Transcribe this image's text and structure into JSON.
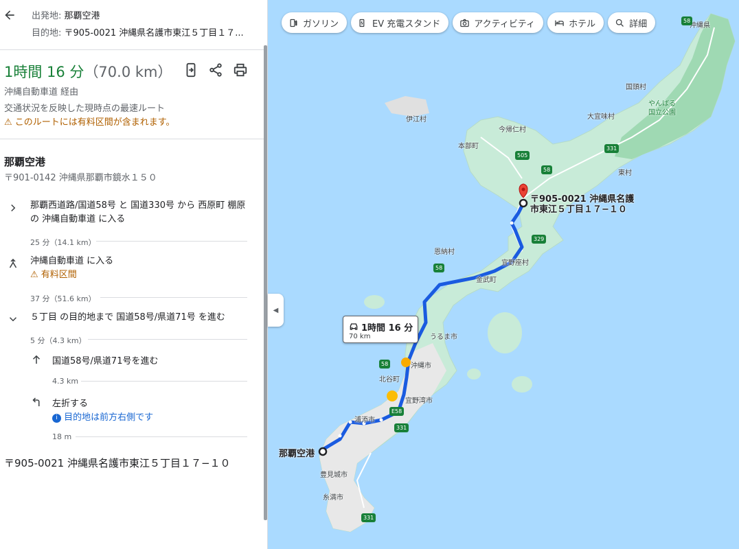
{
  "origin": {
    "label": "出発地:",
    "value": "那覇空港"
  },
  "destination": {
    "label": "目的地:",
    "value": "〒905-0021 沖縄県名護市東江５丁目１７..."
  },
  "summary": {
    "duration": "1時間 16 分",
    "distance": "（70.0 km）",
    "via": "沖縄自動車道 経由",
    "description": "交通状況を反映した現時点の最速ルート",
    "warning": "このルートには有料区間が含まれます。"
  },
  "start": {
    "name": "那覇空港",
    "address": "〒901-0142 沖縄県那覇市鏡水１５０"
  },
  "steps": [
    {
      "icon": "chevron-right-icon",
      "text": "那覇西道路/国道58号 と 国道330号 から 西原町 棚原 の 沖縄自動車道 に入る",
      "meta": "25 分（14.1 km）"
    },
    {
      "icon": "merge-icon",
      "text": "沖縄自動車道 に入る",
      "note": "有料区間",
      "meta": "37 分（51.6 km）"
    },
    {
      "icon": "chevron-down-icon",
      "text": "５丁目 の目的地まで 国道58号/県道71号 を進む",
      "meta": "5 分（4.3 km）"
    }
  ],
  "substeps": [
    {
      "icon": "arrow-up-icon",
      "text": "国道58号/県道71号を進む",
      "meta": "4.3 km"
    },
    {
      "icon": "turn-left-icon",
      "text": "左折する",
      "note": "目的地は前方右側です",
      "meta": "18 m"
    }
  ],
  "destination_full": "〒905-0021 沖縄県名護市東江５丁目１７−１０",
  "chips": [
    {
      "icon": "gas-icon",
      "label": "ガソリン"
    },
    {
      "icon": "ev-charger-icon",
      "label": "EV 充電スタンド"
    },
    {
      "icon": "camera-icon",
      "label": "アクティビティ"
    },
    {
      "icon": "bed-icon",
      "label": "ホテル"
    },
    {
      "icon": "search-icon",
      "label": "詳細"
    }
  ],
  "route_tooltip": {
    "duration": "1時間 16 分",
    "distance": "70 km"
  },
  "map_labels": {
    "prefecture": "沖縄県",
    "kunigami": "国頭村",
    "yanbaru": "やんばる",
    "park": "国立公園",
    "izena": "伊江村",
    "nakijin": "今帰仁村",
    "ogimi": "大宜味村",
    "motobu": "本部町",
    "higashi": "東村",
    "onna": "恩納村",
    "ginoza": "宜野座村",
    "kin": "金武町",
    "uruma": "うるま市",
    "okinawa_city": "沖縄市",
    "chatan": "北谷町",
    "ginowan": "宜野湾市",
    "urasoe": "浦添市",
    "tomigusuku": "豊見城市",
    "itoman": "糸満市",
    "origin_marker": "那覇空港",
    "dest_line1": "〒905-0021 沖縄県名護",
    "dest_line2": "市東江５丁目１７−１０"
  },
  "road_shields": [
    "58",
    "331",
    "505",
    "58",
    "329",
    "58",
    "58",
    "E58",
    "331",
    "331"
  ]
}
